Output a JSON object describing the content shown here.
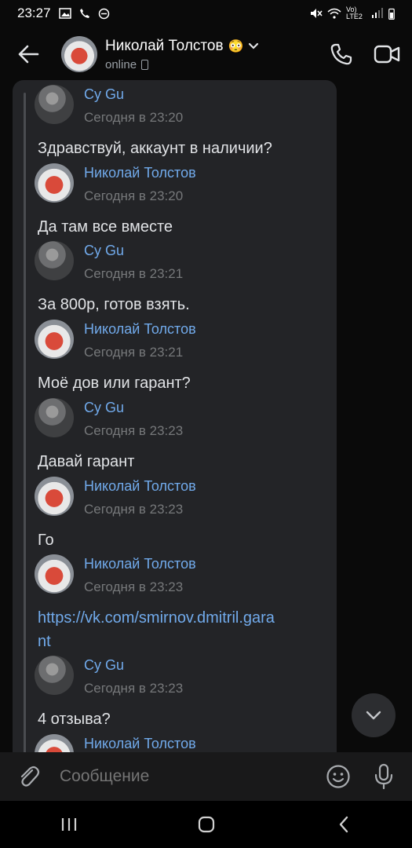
{
  "status_bar": {
    "time": "23:27",
    "network": "Vo) LTE2"
  },
  "header": {
    "name": "Николай Толстов",
    "emoji": "😳",
    "status": "online"
  },
  "messages": [
    {
      "author": "Cy Gu",
      "avatar": "cy",
      "time": "Сегодня в 23:20",
      "text": "Здравствуй, аккаунт в наличии?"
    },
    {
      "author": "Николай Толстов",
      "avatar": "nik",
      "time": "Сегодня в 23:20",
      "text": "Да там все вместе"
    },
    {
      "author": "Cy Gu",
      "avatar": "cy",
      "time": "Сегодня в 23:21",
      "text": "За 800р, готов взять."
    },
    {
      "author": "Николай Толстов",
      "avatar": "nik",
      "time": "Сегодня в 23:21",
      "text": "Моё дов или гарант?"
    },
    {
      "author": "Cy Gu",
      "avatar": "cy",
      "time": "Сегодня в 23:23",
      "text": "Давай гарант"
    },
    {
      "author": "Николай Толстов",
      "avatar": "nik",
      "time": "Сегодня в 23:23",
      "text": "Го"
    },
    {
      "author": "Николай Толстов",
      "avatar": "nik",
      "time": "Сегодня в 23:23",
      "link": "https://vk.com/smirnov.dmitril.garant"
    },
    {
      "author": "Cy Gu",
      "avatar": "cy",
      "time": "Сегодня в 23:23",
      "text": "4 отзыва?"
    },
    {
      "author": "Николай Толстов",
      "avatar": "nik"
    }
  ],
  "composer": {
    "placeholder": "Сообщение"
  },
  "colors": {
    "accent": "#71aaeb",
    "bubble": "#232427",
    "background": "#0a0a0a"
  }
}
